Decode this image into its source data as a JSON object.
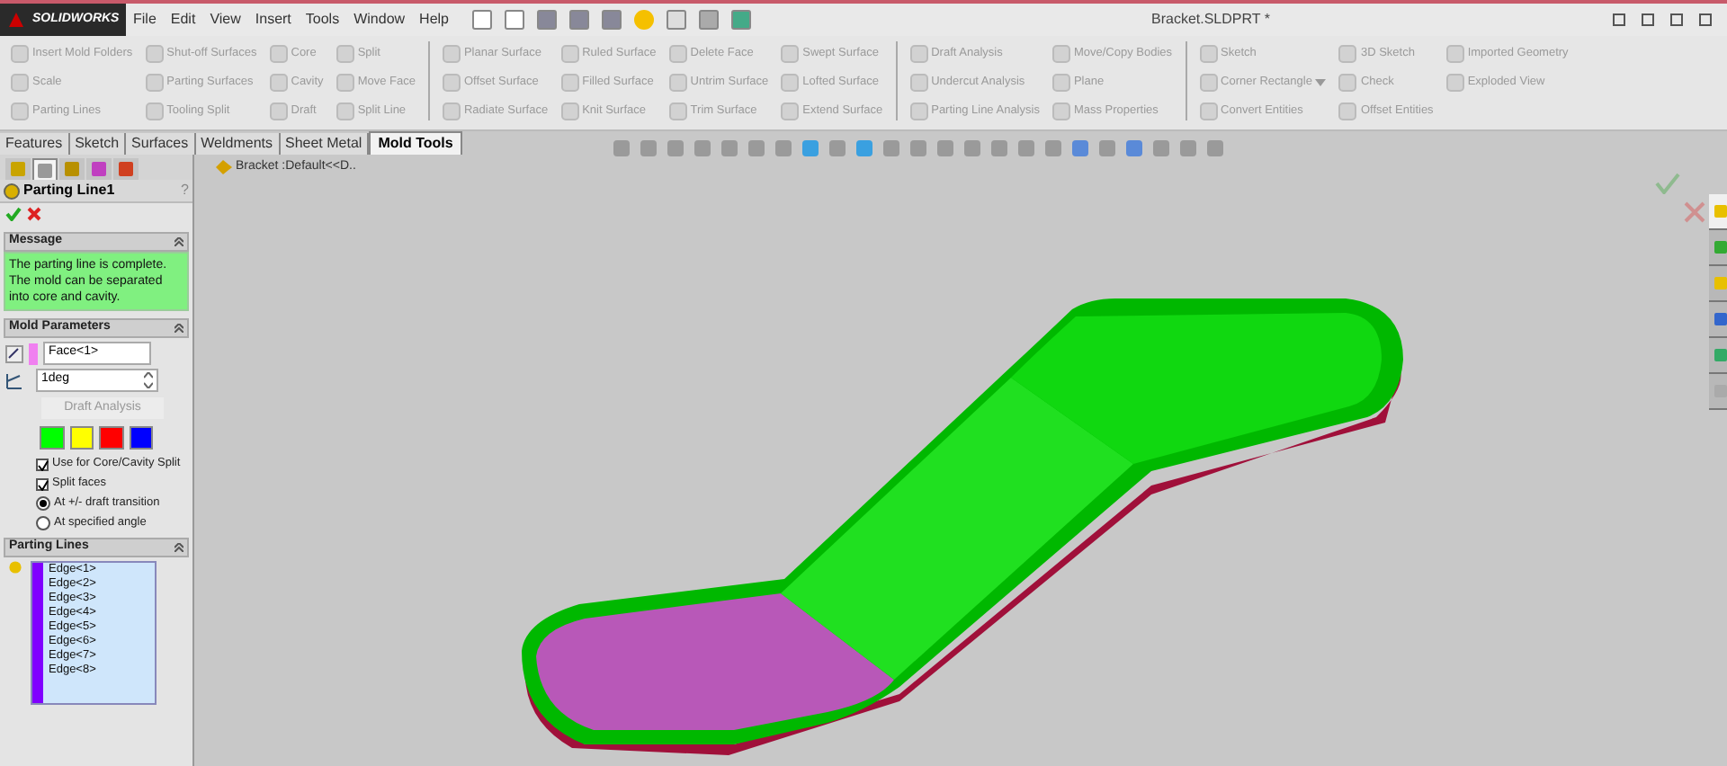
{
  "window": {
    "logo": "SOLIDWORKS",
    "title": "Bracket.SLDPRT *"
  },
  "menu": [
    "File",
    "Edit",
    "View",
    "Insert",
    "Tools",
    "Window",
    "Help"
  ],
  "ribbon": [
    {
      "items": [
        {
          "label": "Insert Mold Folders",
          "disabled": true
        },
        {
          "label": "Scale",
          "disabled": true
        },
        {
          "label": "Parting Lines",
          "disabled": true
        }
      ]
    },
    {
      "items": [
        {
          "label": "Shut-off Surfaces",
          "disabled": true
        },
        {
          "label": "Parting Surfaces",
          "disabled": true
        },
        {
          "label": "Tooling Split",
          "disabled": true
        }
      ]
    },
    {
      "items": [
        {
          "label": "Core",
          "disabled": true
        },
        {
          "label": "Cavity",
          "disabled": true
        },
        {
          "label": "Draft",
          "disabled": true
        }
      ]
    },
    {
      "items": [
        {
          "label": "Split",
          "disabled": true
        },
        {
          "label": "Move Face",
          "disabled": true
        },
        {
          "label": "Split Line",
          "disabled": true
        }
      ],
      "separator_after": true
    },
    {
      "items": [
        {
          "label": "Planar Surface",
          "disabled": true
        },
        {
          "label": "Offset Surface",
          "disabled": true
        },
        {
          "label": "Radiate Surface",
          "disabled": true
        }
      ]
    },
    {
      "items": [
        {
          "label": "Ruled Surface",
          "disabled": true
        },
        {
          "label": "Filled Surface",
          "disabled": true
        },
        {
          "label": "Knit Surface",
          "disabled": true
        }
      ]
    },
    {
      "items": [
        {
          "label": "Delete Face",
          "disabled": true
        },
        {
          "label": "Untrim Surface",
          "disabled": true
        },
        {
          "label": "Trim Surface",
          "disabled": true
        }
      ]
    },
    {
      "items": [
        {
          "label": "Swept Surface",
          "disabled": true
        },
        {
          "label": "Lofted Surface",
          "disabled": true
        },
        {
          "label": "Extend Surface",
          "disabled": true
        }
      ],
      "separator_after": true
    },
    {
      "items": [
        {
          "label": "Draft Analysis",
          "disabled": true
        },
        {
          "label": "Undercut Analysis",
          "disabled": true
        },
        {
          "label": "Parting Line Analysis",
          "disabled": true
        }
      ]
    },
    {
      "items": [
        {
          "label": "Move/Copy Bodies",
          "disabled": true
        },
        {
          "label": "Plane",
          "disabled": true
        },
        {
          "label": "Mass Properties",
          "disabled": true
        }
      ],
      "separator_after": true
    },
    {
      "items": [
        {
          "label": "Sketch",
          "disabled": true
        },
        {
          "label": "Corner Rectangle",
          "disabled": true,
          "dropdown": true
        },
        {
          "label": "Convert Entities",
          "disabled": true
        }
      ]
    },
    {
      "items": [
        {
          "label": "3D Sketch",
          "disabled": true
        },
        {
          "label": "Check",
          "disabled": true
        },
        {
          "label": "Offset Entities",
          "disabled": true
        }
      ]
    },
    {
      "items": [
        {
          "label": "Imported Geometry",
          "disabled": true
        },
        {
          "label": "Exploded View",
          "disabled": true
        }
      ]
    }
  ],
  "tabs": [
    {
      "label": "Features",
      "selected": false
    },
    {
      "label": "Sketch",
      "selected": false
    },
    {
      "label": "Surfaces",
      "selected": false
    },
    {
      "label": "Weldments",
      "selected": false
    },
    {
      "label": "Sheet Metal",
      "selected": false
    },
    {
      "label": "Mold Tools",
      "selected": true
    }
  ],
  "panel_tabs": [
    {
      "selected": false
    },
    {
      "selected": true
    },
    {
      "selected": false
    },
    {
      "selected": false
    },
    {
      "selected": false
    }
  ],
  "property_manager": {
    "title": "Parting Line1",
    "help": "?",
    "message": {
      "heading": "Message",
      "text": "The parting line is complete. The mold can be separated into core and cavity."
    },
    "mold_parameters": {
      "heading": "Mold Parameters",
      "face": "Face<1>",
      "angle": "1deg",
      "draft_button": "Draft Analysis",
      "swatches": [
        {
          "color": "#00ff00"
        },
        {
          "color": "#ffff00"
        },
        {
          "color": "#ff0000"
        },
        {
          "color": "#0000ff"
        }
      ],
      "options": [
        {
          "kind": "checkbox",
          "label": "Use for Core/Cavity Split",
          "checked": true
        },
        {
          "kind": "checkbox",
          "label": "Split faces",
          "checked": true
        },
        {
          "kind": "radio",
          "label": "At +/- draft transition",
          "selected": true
        },
        {
          "kind": "radio",
          "label": "At specified angle",
          "selected": false
        }
      ]
    },
    "parting_lines": {
      "heading": "Parting Lines",
      "items": [
        "Edge<1>",
        "Edge<2>",
        "Edge<3>",
        "Edge<4>",
        "Edge<5>",
        "Edge<6>",
        "Edge<7>",
        "Edge<8>"
      ]
    }
  },
  "tree": {
    "item": "Bracket :Default<<D.."
  },
  "task_pane_tabs": [
    {
      "selected": true
    },
    {
      "selected": false
    },
    {
      "selected": false
    },
    {
      "selected": false
    },
    {
      "selected": false
    },
    {
      "selected": false
    }
  ]
}
